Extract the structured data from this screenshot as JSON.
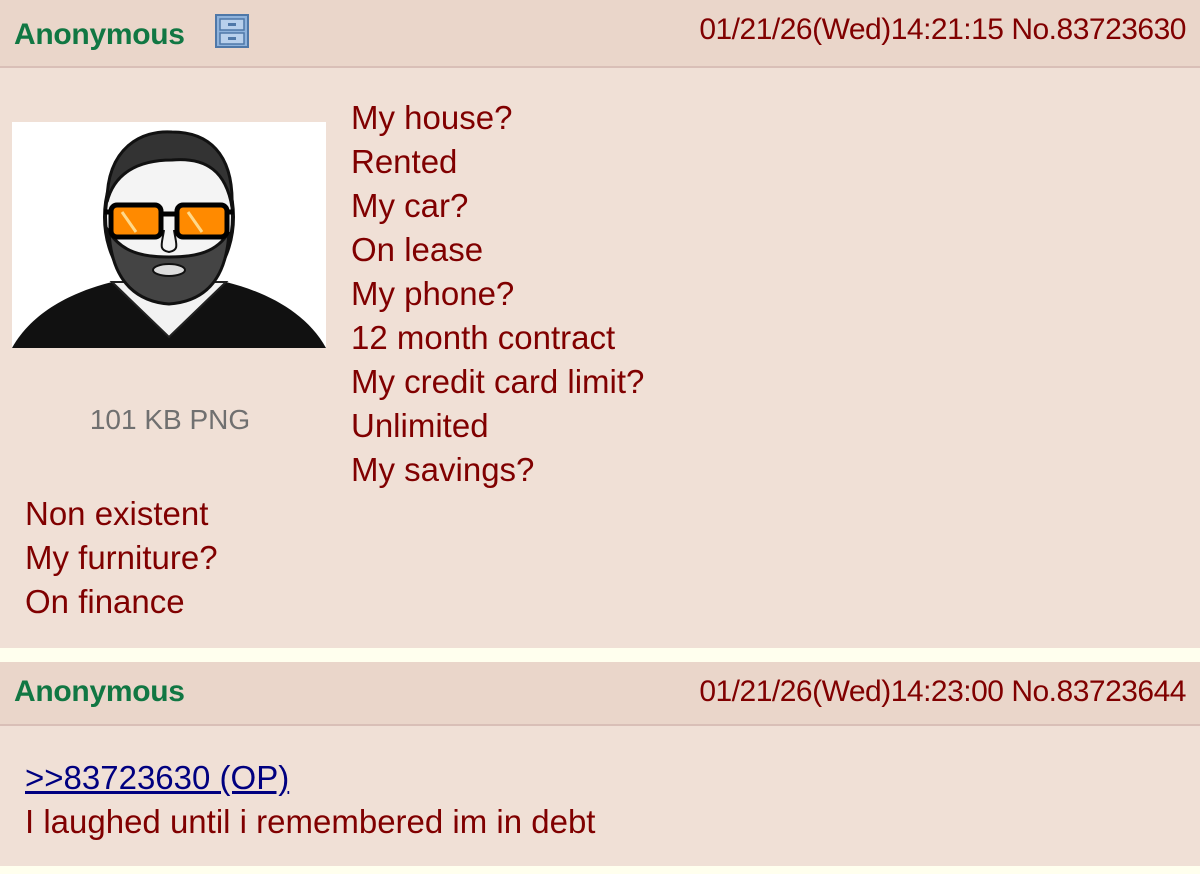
{
  "op_post": {
    "name": "Anonymous",
    "meta": "01/21/26(Wed)14:21:15 No.83723630",
    "flag_icon": "filing-cabinet-icon",
    "file_info": "101 KB PNG",
    "message_lines": [
      "My house?",
      "Rented",
      "My car?",
      "On lease",
      "My phone?",
      "12 month contract",
      "My credit card limit?",
      "Unlimited",
      "My savings?",
      "Non existent",
      "My furniture?",
      "On finance"
    ]
  },
  "reply_post": {
    "name": "Anonymous",
    "meta": "01/21/26(Wed)14:23:00 No.83723644",
    "quote_link": ">>83723630 (OP)",
    "text": "I laughed until i remembered im in debt"
  },
  "colors": {
    "name": "#117743",
    "text": "#800000",
    "post_bg": "#f0e0d6",
    "header_bg": "#ead6ca",
    "link": "#000080",
    "page_bg": "#ffffee"
  }
}
